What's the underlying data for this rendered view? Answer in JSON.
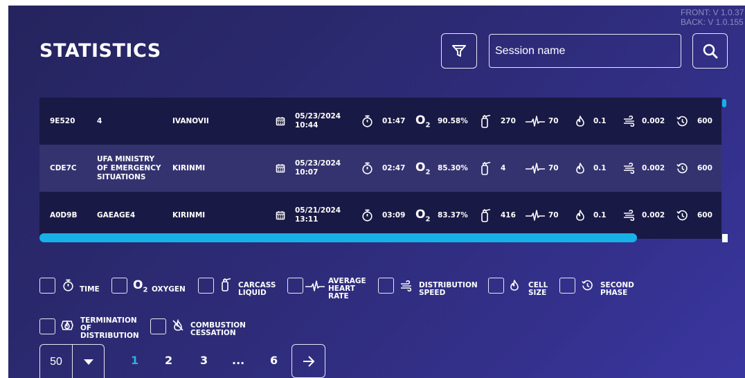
{
  "version": {
    "front": "FRONT: V 1.0.37",
    "back": "BACK: V 1.0.155"
  },
  "header": {
    "title": "STATISTICS",
    "search_placeholder": "Session name"
  },
  "rows": [
    {
      "id": "9E520",
      "org": [
        "4"
      ],
      "name": "IVANOVII",
      "date": "05/23/2024",
      "time": "10:44",
      "duration": "01:47",
      "oxygen": "90.58%",
      "liquid": "270",
      "heart_rate": "70",
      "cell_size": "0.1",
      "speed": "0.002",
      "phase": "600"
    },
    {
      "id": "CDE7C",
      "org": [
        "UFA MINISTRY",
        "OF EMERGENCY",
        "SITUATIONS"
      ],
      "name": "KIRINMI",
      "date": "05/23/2024",
      "time": "10:07",
      "duration": "02:47",
      "oxygen": "85.30%",
      "liquid": "4",
      "heart_rate": "70",
      "cell_size": "0.1",
      "speed": "0.002",
      "phase": "600"
    },
    {
      "id": "A0D9B",
      "org": [
        "GAEAGE4"
      ],
      "name": "KIRINMI",
      "date": "05/21/2024",
      "time": "13:11",
      "duration": "03:09",
      "oxygen": "83.37%",
      "liquid": "416",
      "heart_rate": "70",
      "cell_size": "0.1",
      "speed": "0.002",
      "phase": "600"
    }
  ],
  "o2_symbol": {
    "main": "O",
    "sub": "2"
  },
  "filters": [
    {
      "icon": "stopwatch-icon",
      "lines": [
        "TIME"
      ]
    },
    {
      "icon": "o2-icon",
      "lines": [
        "OXYGEN"
      ]
    },
    {
      "icon": "extinguisher-icon",
      "lines": [
        "CARCASS",
        "LIQUID"
      ]
    },
    {
      "icon": "heartbeat-icon",
      "lines": [
        "AVERAGE",
        "HEART",
        "RATE"
      ]
    },
    {
      "icon": "wind-icon",
      "lines": [
        "DISTRIBUTION",
        "SPEED"
      ]
    },
    {
      "icon": "flame-icon",
      "lines": [
        "CELL",
        "SIZE"
      ]
    },
    {
      "icon": "history-icon",
      "lines": [
        "SECOND",
        "PHASE"
      ]
    },
    {
      "icon": "fire-alarm-icon",
      "lines": [
        "TERMINATION",
        "OF",
        "DISTRIBUTION"
      ]
    },
    {
      "icon": "no-fire-icon",
      "lines": [
        "COMBUSTION",
        "CESSATION"
      ]
    }
  ],
  "pagination": {
    "page_size": "50",
    "pages": [
      "1",
      "2",
      "3",
      "...",
      "6"
    ],
    "current": "1"
  },
  "colors": {
    "accent": "#17b1e8",
    "background": "#2c2a72",
    "row_alt": "#34336f"
  }
}
